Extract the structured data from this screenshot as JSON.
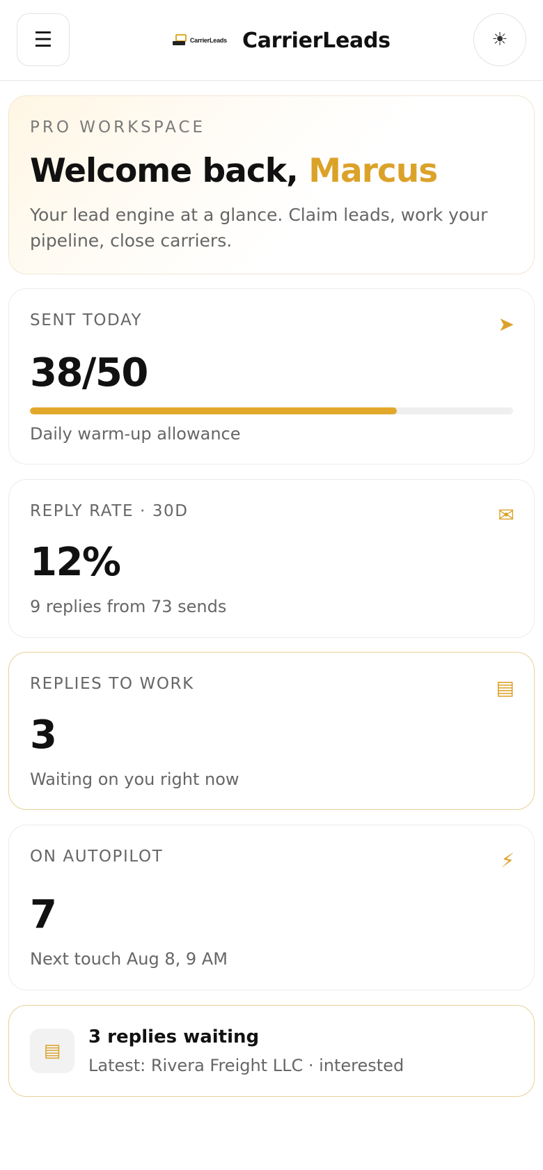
{
  "header": {
    "menu_icon": "☰",
    "brand_logo_text": "CarrierLeads",
    "brand_name": "CarrierLeads",
    "theme_icon": "☀"
  },
  "hero": {
    "eyebrow": "PRO WORKSPACE",
    "greeting": "Welcome back, ",
    "user_name": "Marcus",
    "subtitle": "Your lead engine at a glance. Claim leads, work your pipeline, close carriers."
  },
  "stats": {
    "sent_today": {
      "label": "SENT TODAY",
      "icon": "➤",
      "icon_name": "send-icon",
      "value": "38/50",
      "progress_fraction": 0.76,
      "caption": "Daily warm-up allowance"
    },
    "reply_rate": {
      "label": "REPLY RATE · 30D",
      "icon": "✉",
      "icon_name": "envelope-icon",
      "value": "12%",
      "caption": "9 replies from 73 sends"
    },
    "replies_to_work": {
      "label": "REPLIES TO WORK",
      "icon": "▤",
      "icon_name": "inbox-icon",
      "value": "3",
      "caption": "Waiting on you right now"
    },
    "autopilot": {
      "label": "ON AUTOPILOT",
      "icon": "⚡",
      "icon_name": "lightning-icon",
      "value": "7",
      "caption": "Next touch Aug 8, 9 AM"
    }
  },
  "notice": {
    "icon": "▤",
    "title": "3 replies waiting",
    "subtitle": "Latest: Rivera Freight LLC · interested"
  },
  "colors": {
    "accent": "#dba22a",
    "progress": "#e2a82b",
    "highlight_border": "#e6d199"
  }
}
